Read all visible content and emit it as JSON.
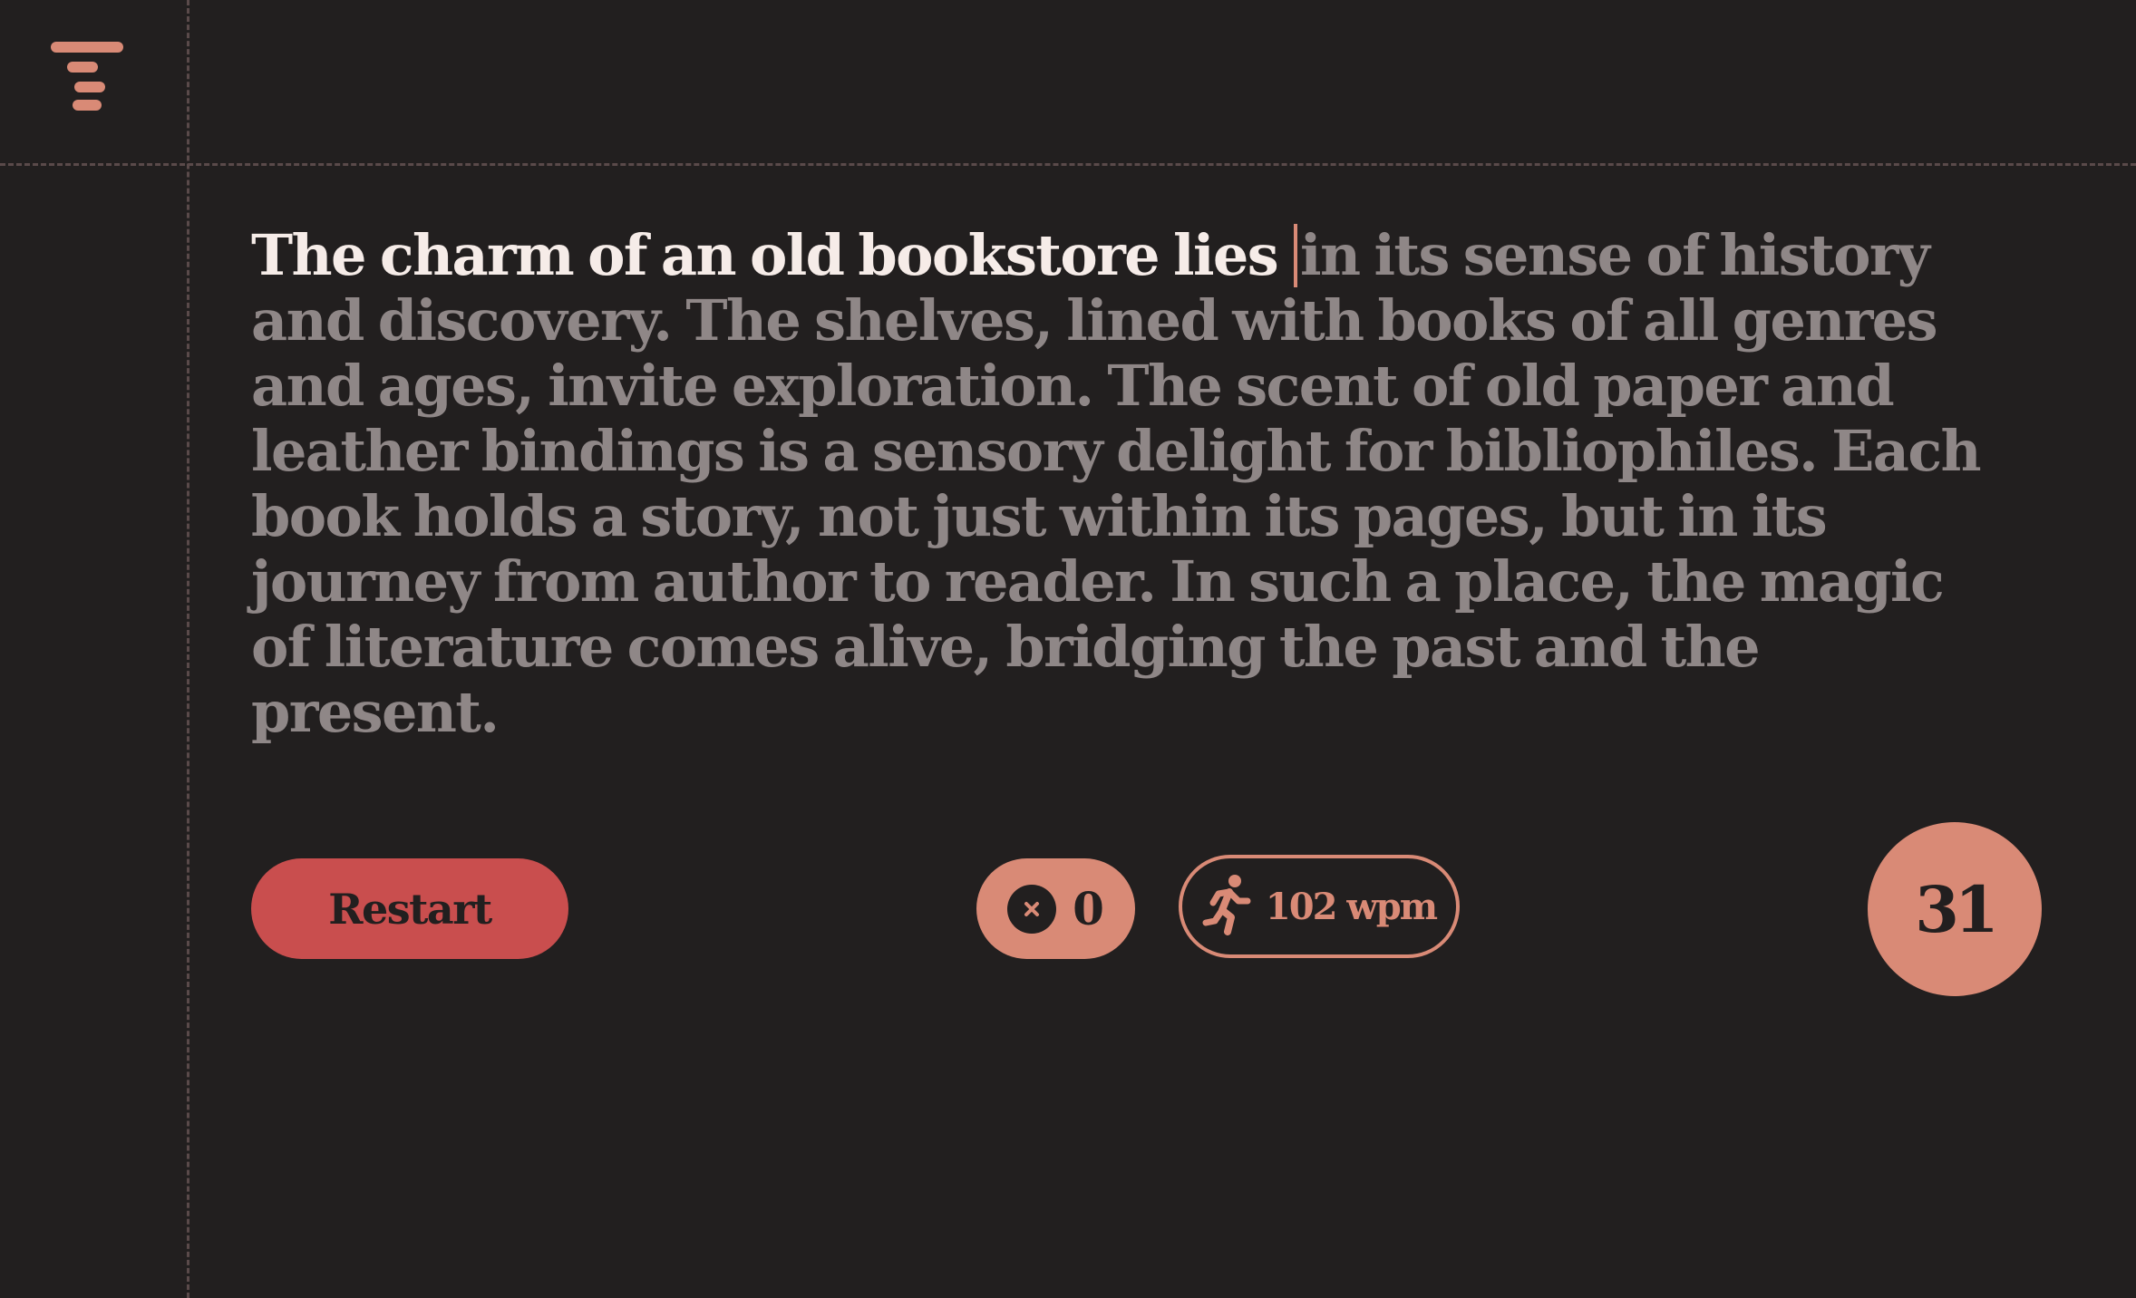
{
  "app": {
    "logo_icon": "tapered-lines-icon"
  },
  "passage": {
    "typed": "The charm of an old bookstore lies ",
    "remaining": "in its sense of history and discovery. The shelves, lined with books of all genres and ages, invite exploration. The scent of old paper and leather bindings is a sensory delight for bibliophiles. Each book holds a story, not just within its pages, but in its journey from author to reader. In such a place, the magic of literature comes alive, bridging the past and the present."
  },
  "controls": {
    "restart_label": "Restart"
  },
  "stats": {
    "errors_icon": "x-circle-icon",
    "errors": "0",
    "speed_icon": "running-person-icon",
    "speed": "102 wpm",
    "timer": "31"
  },
  "colors": {
    "background": "#221f1f",
    "accent": "#d98a76",
    "restart": "#c94e4e",
    "typed_text": "#f6ece8",
    "pending_text": "#8f8787"
  }
}
